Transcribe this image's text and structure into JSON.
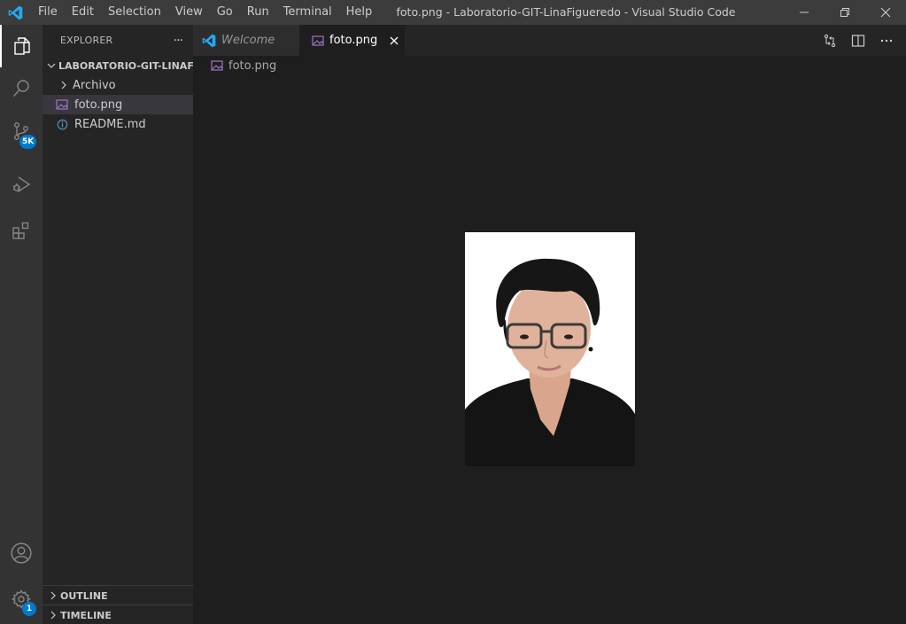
{
  "titlebar": {
    "menu": [
      "File",
      "Edit",
      "Selection",
      "View",
      "Go",
      "Run",
      "Terminal",
      "Help"
    ],
    "window_title": "foto.png - Laboratorio-GIT-LinaFigueredo - Visual Studio Code"
  },
  "activity_bar": {
    "items": [
      {
        "icon": "files-icon",
        "active": true
      },
      {
        "icon": "search-icon"
      },
      {
        "icon": "source-control-icon",
        "badge": "5K"
      },
      {
        "icon": "run-debug-icon"
      },
      {
        "icon": "extensions-icon"
      }
    ],
    "bottom": [
      {
        "icon": "accounts-icon"
      },
      {
        "icon": "settings-gear-icon",
        "badge": "1"
      }
    ]
  },
  "sidebar": {
    "title": "EXPLORER",
    "more": "···",
    "folder": "LABORATORIO-GIT-LINAFI...",
    "tree": [
      {
        "label": "Archivo",
        "type": "folder"
      },
      {
        "label": "foto.png",
        "type": "image",
        "selected": true
      },
      {
        "label": "README.md",
        "type": "info"
      }
    ],
    "outline": "OUTLINE",
    "timeline": "TIMELINE"
  },
  "tabs": [
    {
      "label": "Welcome",
      "active": false
    },
    {
      "label": "foto.png",
      "active": true
    }
  ],
  "breadcrumb": "foto.png",
  "colors": {
    "accent": "#007acc",
    "titlebar": "#3c3c3c",
    "activitybar": "#333333",
    "sidebar": "#252526",
    "editor": "#1e1e1e"
  }
}
